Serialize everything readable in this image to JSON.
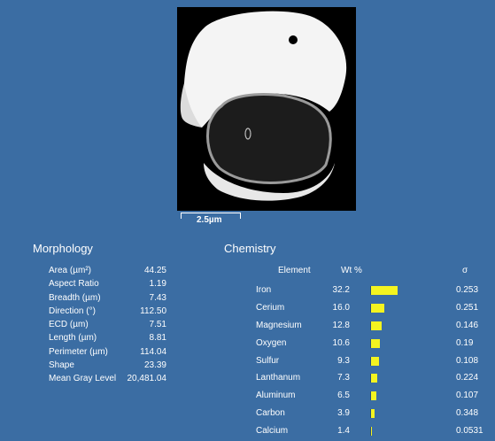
{
  "image": {
    "scalebar_label": "2.5µm"
  },
  "morphology": {
    "title": "Morphology",
    "rows": [
      {
        "label": "Area (µm²)",
        "value": "44.25"
      },
      {
        "label": "Aspect Ratio",
        "value": "1.19"
      },
      {
        "label": "Breadth (µm)",
        "value": "7.43"
      },
      {
        "label": "Direction (°)",
        "value": "112.50"
      },
      {
        "label": "ECD (µm)",
        "value": "7.51"
      },
      {
        "label": "Length (µm)",
        "value": "8.81"
      },
      {
        "label": "Perimeter (µm)",
        "value": "114.04"
      },
      {
        "label": "Shape",
        "value": "23.39"
      },
      {
        "label": "Mean Gray Level",
        "value": "20,481.04"
      }
    ]
  },
  "chemistry": {
    "title": "Chemistry",
    "headers": {
      "element": "Element",
      "wt": "Wt %",
      "sigma": "σ"
    },
    "bar_color": "#f4f41f",
    "rows": [
      {
        "element": "Iron",
        "wt": "32.2",
        "wt_value": 32.2,
        "sigma": "0.253"
      },
      {
        "element": "Cerium",
        "wt": "16.0",
        "wt_value": 16.0,
        "sigma": "0.251"
      },
      {
        "element": "Magnesium",
        "wt": "12.8",
        "wt_value": 12.8,
        "sigma": "0.146"
      },
      {
        "element": "Oxygen",
        "wt": "10.6",
        "wt_value": 10.6,
        "sigma": "0.19"
      },
      {
        "element": "Sulfur",
        "wt": "9.3",
        "wt_value": 9.3,
        "sigma": "0.108"
      },
      {
        "element": "Lanthanum",
        "wt": "7.3",
        "wt_value": 7.3,
        "sigma": "0.224"
      },
      {
        "element": "Aluminum",
        "wt": "6.5",
        "wt_value": 6.5,
        "sigma": "0.107"
      },
      {
        "element": "Carbon",
        "wt": "3.9",
        "wt_value": 3.9,
        "sigma": "0.348"
      },
      {
        "element": "Calcium",
        "wt": "1.4",
        "wt_value": 1.4,
        "sigma": "0.0531"
      }
    ]
  }
}
